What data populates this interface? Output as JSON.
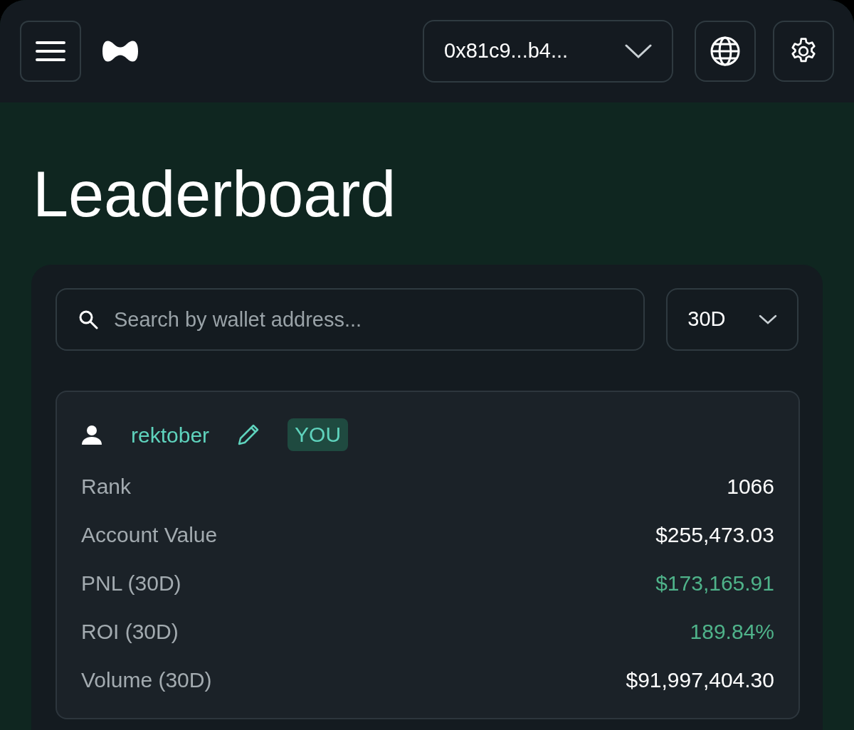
{
  "header": {
    "wallet": "0x81c9...b4..."
  },
  "title": "Leaderboard",
  "search": {
    "placeholder": "Search by wallet address..."
  },
  "period": {
    "value": "30D"
  },
  "card": {
    "username": "rektober",
    "badge": "YOU",
    "rows": [
      {
        "label": "Rank",
        "value": "1066",
        "kind": "plain"
      },
      {
        "label": "Account Value",
        "value": "$255,473.03",
        "kind": "plain"
      },
      {
        "label": "PNL (30D)",
        "value": "$173,165.91",
        "kind": "positive"
      },
      {
        "label": "ROI (30D)",
        "value": "189.84%",
        "kind": "positive"
      },
      {
        "label": "Volume (30D)",
        "value": "$91,997,404.30",
        "kind": "plain"
      }
    ]
  }
}
